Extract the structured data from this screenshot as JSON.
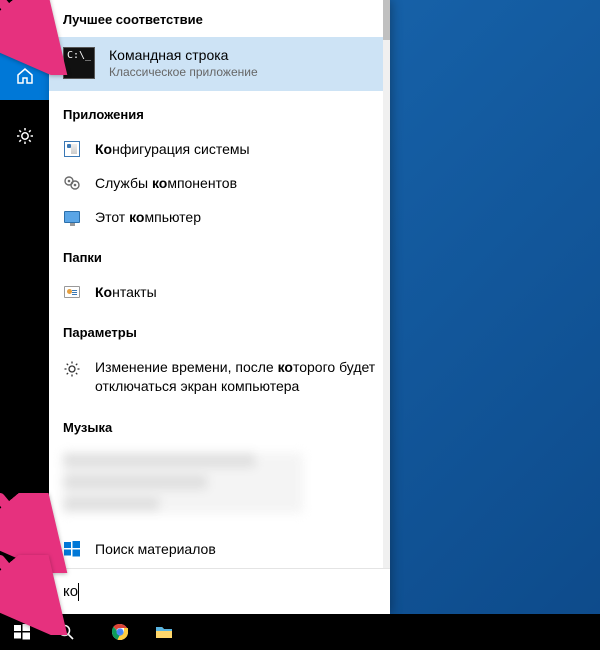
{
  "search": {
    "query": "ко",
    "store_search_label": "Поиск материалов"
  },
  "sections": {
    "best_match": "Лучшее соответствие",
    "apps": "Приложения",
    "folders": "Папки",
    "settings": "Параметры",
    "music": "Музыка"
  },
  "best_match": {
    "title": "Командная строка",
    "subtitle": "Классическое приложение",
    "icon_prompt": "C:\\_"
  },
  "apps": [
    {
      "icon": "sysconf",
      "html": "<b>Ко</b>нфигурация системы"
    },
    {
      "icon": "compsvc",
      "html": "Службы <b>ко</b>мпонентов"
    },
    {
      "icon": "thispc",
      "html": "Этот <b>ко</b>мпьютер"
    }
  ],
  "folders": [
    {
      "icon": "contacts",
      "html": "<b>Ко</b>нтакты"
    }
  ],
  "settings": [
    {
      "icon": "gear",
      "html": "Изменение времени, после <b>ко</b>торого будет отключаться экран компьютера"
    }
  ],
  "rail": {
    "hamburger": "hamburger-icon",
    "home": "home-icon",
    "gear": "gear-icon"
  },
  "taskbar": {
    "items": [
      "start",
      "search",
      "chrome",
      "explorer"
    ]
  },
  "colors": {
    "accent": "#0078d7",
    "arrow": "#e6317e",
    "best_match_bg": "#cde3f5"
  }
}
